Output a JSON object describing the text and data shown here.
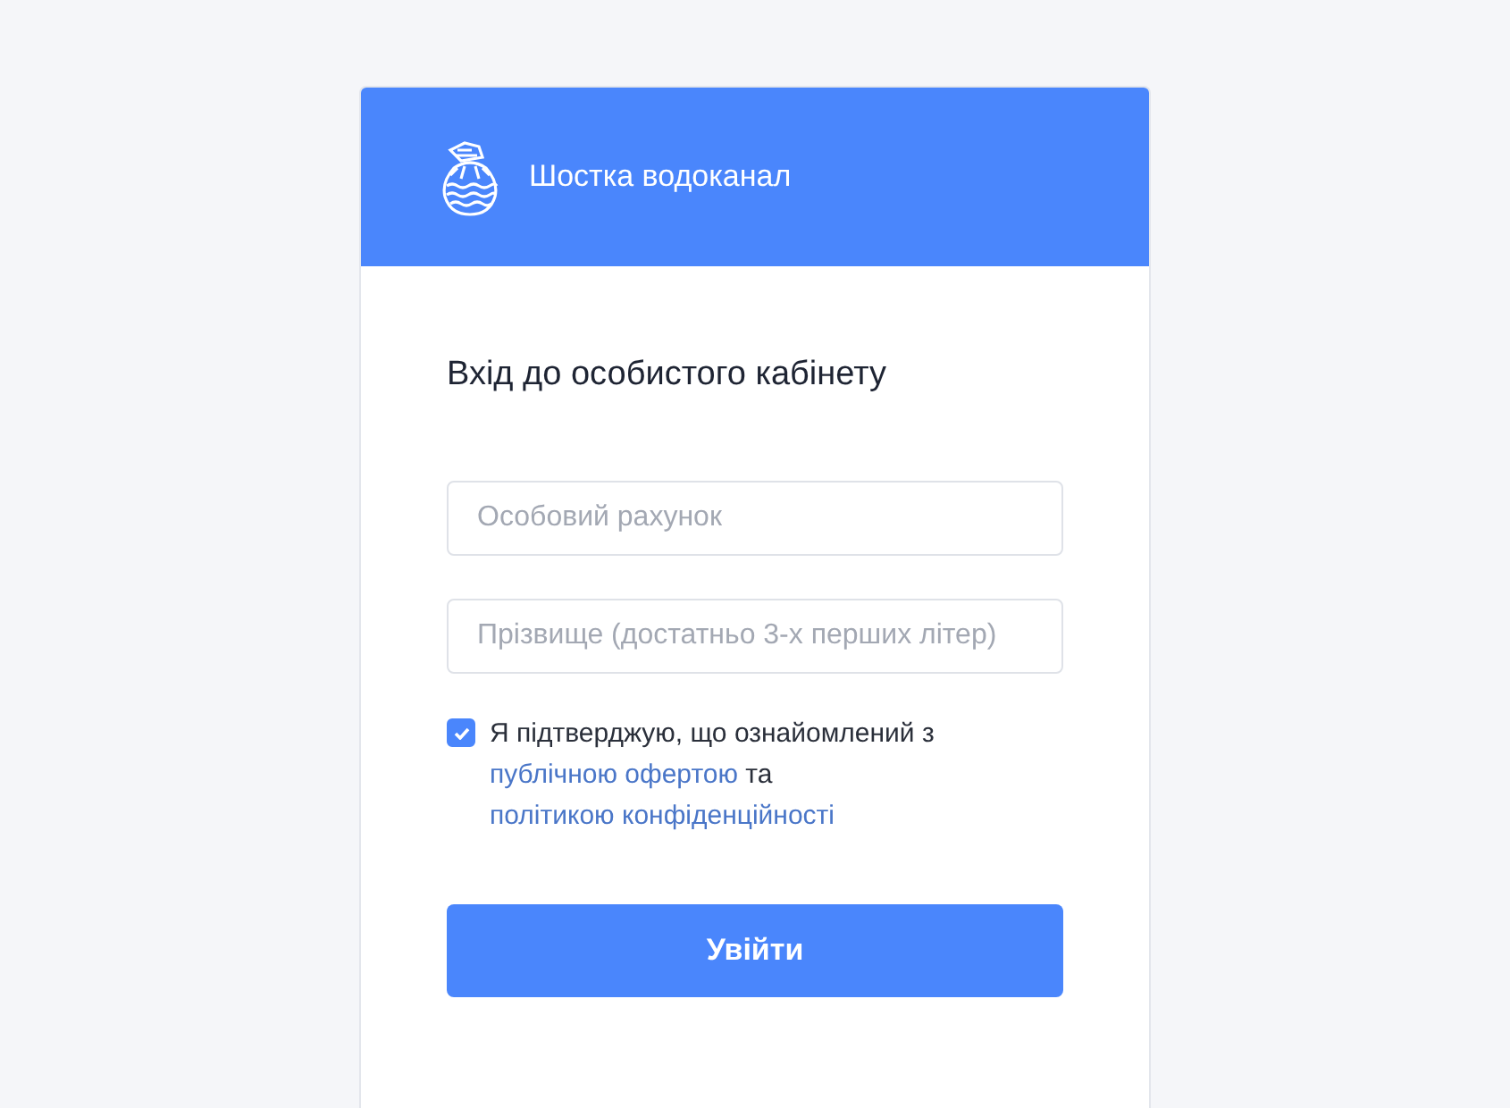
{
  "header": {
    "brand": "Шостка водоканал"
  },
  "form": {
    "title": "Вхід до особистого кабінету",
    "fields": [
      {
        "placeholder": "Особовий рахунок"
      },
      {
        "placeholder": "Прізвище (достатньо 3-х перших літер)"
      }
    ],
    "consent": {
      "checked": true,
      "parts": [
        {
          "kind": "text",
          "text": "Я підтверджую, що ознайомлений з "
        },
        {
          "kind": "link",
          "text": "публічною офертою"
        },
        {
          "kind": "text",
          "text": " та "
        },
        {
          "kind": "link",
          "text": "політикою конфіденційності"
        }
      ]
    },
    "submit": "Увійти"
  }
}
